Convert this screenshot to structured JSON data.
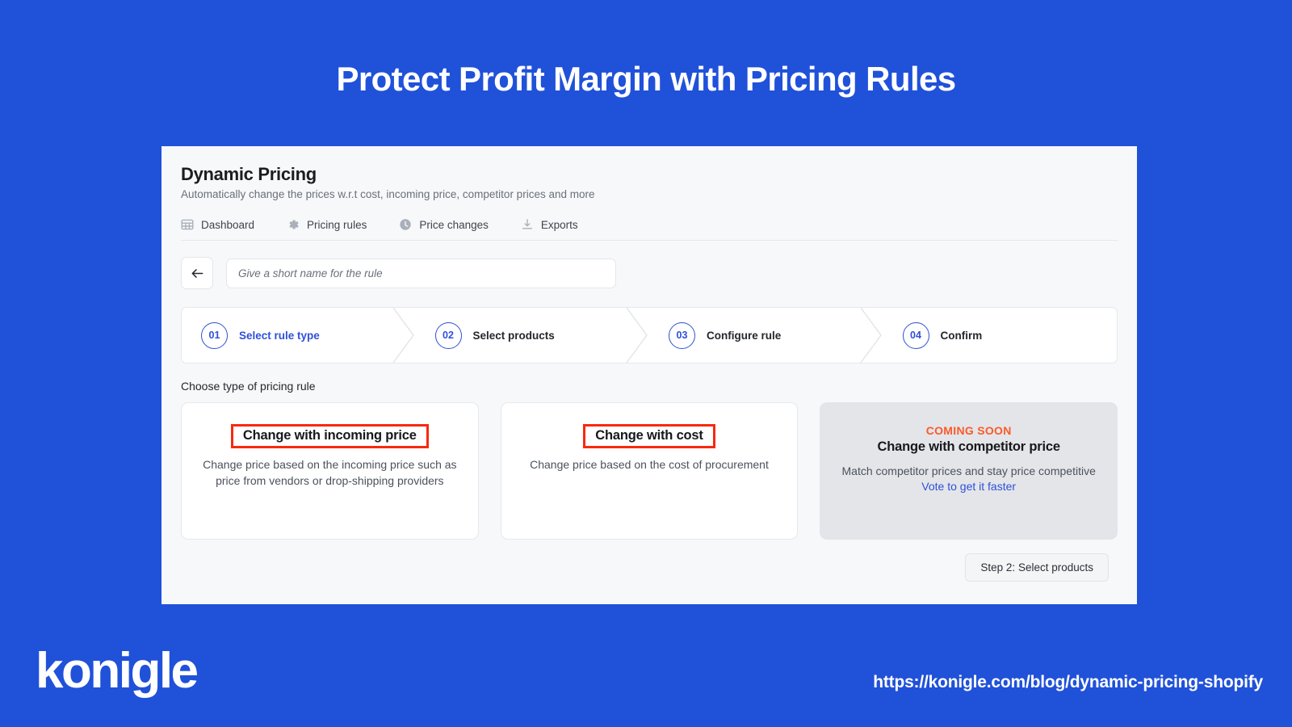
{
  "slide": {
    "headline": "Protect Profit Margin with Pricing Rules",
    "brand_logo_text": "konigle",
    "url": "https://konigle.com/blog/dynamic-pricing-shopify",
    "background_color": "#2051d9",
    "accent_color": "#2f50d8",
    "annotation_color": "#f8290e"
  },
  "app": {
    "title": "Dynamic Pricing",
    "subtitle": "Automatically change the prices w.r.t cost, incoming price, competitor prices and more",
    "tabs": [
      {
        "label": "Dashboard",
        "icon": "table-icon"
      },
      {
        "label": "Pricing rules",
        "icon": "gear-icon"
      },
      {
        "label": "Price changes",
        "icon": "clock-icon"
      },
      {
        "label": "Exports",
        "icon": "download-icon"
      }
    ],
    "rule_name": {
      "placeholder": "Give a short name for the rule",
      "value": ""
    },
    "stepper": [
      {
        "num": "01",
        "label": "Select rule type",
        "active": true
      },
      {
        "num": "02",
        "label": "Select products",
        "active": false
      },
      {
        "num": "03",
        "label": "Configure rule",
        "active": false
      },
      {
        "num": "04",
        "label": "Confirm",
        "active": false
      }
    ],
    "choose_label": "Choose type of pricing rule",
    "cards": [
      {
        "title": "Change with incoming price",
        "desc": "Change price based on the incoming price such as price from vendors or drop-shipping providers",
        "badge": "",
        "link": "",
        "disabled": false,
        "highlighted": true
      },
      {
        "title": "Change with cost",
        "desc": "Change price based on the cost of procurement",
        "badge": "",
        "link": "",
        "disabled": false,
        "highlighted": true
      },
      {
        "title": "Change with competitor price",
        "desc": "Match competitor prices and stay price competitive",
        "badge": "COMING SOON",
        "link": "Vote to get it faster",
        "disabled": true,
        "highlighted": false
      }
    ],
    "next_button": "Step 2: Select products"
  }
}
